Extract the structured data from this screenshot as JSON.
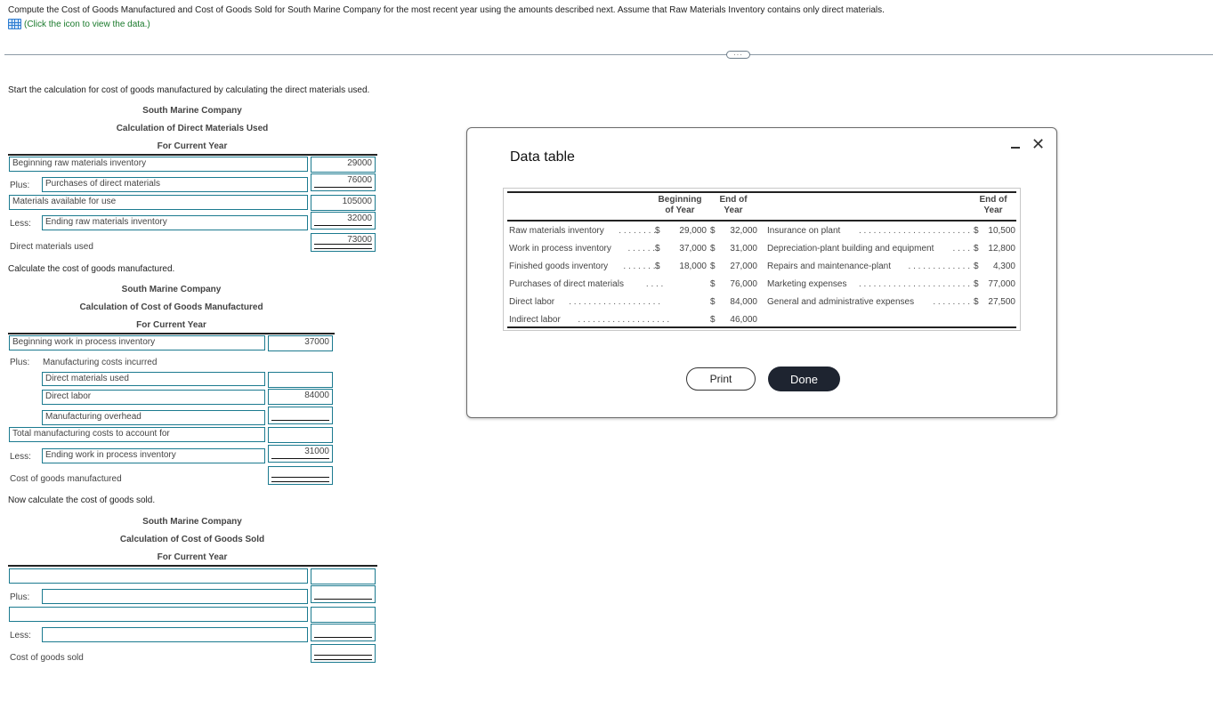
{
  "question": {
    "text": "Compute the Cost of Goods Manufactured and Cost of Goods Sold for South Marine Company for the most recent year using the amounts described next. Assume that Raw Materials Inventory contains only direct materials.",
    "data_link": "(Click the icon to view the data.)",
    "data_icon": "table-grid-icon",
    "separator_handle": "···"
  },
  "dmu": {
    "instruction": "Start the calculation for cost of goods manufactured by calculating the direct materials used.",
    "company": "South Marine Company",
    "title": "Calculation of Direct Materials Used",
    "period": "For Current Year",
    "rows": [
      {
        "prefix": "",
        "label": "Beginning raw materials inventory",
        "value": "29000"
      },
      {
        "prefix": "Plus:",
        "label": "Purchases of direct materials",
        "value": "76000"
      },
      {
        "prefix": "",
        "label": "Materials available for use",
        "value": "105000"
      },
      {
        "prefix": "Less:",
        "label": "Ending raw materials inventory",
        "value": "32000"
      },
      {
        "prefix": "",
        "label": "Direct materials used",
        "value": "73000"
      }
    ]
  },
  "cogm": {
    "instruction": "Calculate the cost of goods manufactured.",
    "company": "South Marine Company",
    "title": "Calculation of Cost of Goods Manufactured",
    "period": "For Current Year",
    "rows": [
      {
        "prefix": "",
        "label": "Beginning work in process inventory",
        "value": "37000"
      },
      {
        "prefix": "Plus:",
        "label": "Manufacturing costs incurred",
        "value": ""
      },
      {
        "prefix": "",
        "label": "Direct materials used",
        "value": ""
      },
      {
        "prefix": "",
        "label": "Direct labor",
        "value": "84000"
      },
      {
        "prefix": "",
        "label": "Manufacturing overhead",
        "value": ""
      },
      {
        "prefix": "",
        "label": "Total manufacturing costs to account for",
        "value": ""
      },
      {
        "prefix": "Less:",
        "label": "Ending work in process inventory",
        "value": "31000"
      },
      {
        "prefix": "",
        "label": "Cost of goods manufactured",
        "value": ""
      }
    ]
  },
  "cogs": {
    "instruction": "Now calculate the cost of goods sold.",
    "company": "South Marine Company",
    "title": "Calculation of Cost of Goods Sold",
    "period": "For Current Year",
    "rows": [
      {
        "prefix": "",
        "label": "",
        "value": ""
      },
      {
        "prefix": "Plus:",
        "label": "",
        "value": ""
      },
      {
        "prefix": "",
        "label": "",
        "value": ""
      },
      {
        "prefix": "Less:",
        "label": "",
        "value": ""
      },
      {
        "prefix": "",
        "label": "Cost of goods sold",
        "value": ""
      }
    ]
  },
  "modal": {
    "title": "Data table",
    "minimize_icon": "minimize-icon",
    "close_icon": "close-icon",
    "left_headers": {
      "beginning": "Beginning of Year",
      "beginning_l1": "Beginning",
      "beginning_l2": "of Year",
      "end_l1": "End of",
      "end_l2": "Year"
    },
    "right_headers": {
      "end_l1": "End of",
      "end_l2": "Year"
    },
    "left_rows": [
      {
        "label": "Raw materials inventory",
        "dots": ". . . . . . . .",
        "beg_sym": "$",
        "beg": "29,000",
        "end_sym": "$",
        "end": "32,000"
      },
      {
        "label": "Work in process inventory",
        "dots": ". . . . . . .",
        "beg_sym": "$",
        "beg": "37,000",
        "end_sym": "$",
        "end": "31,000"
      },
      {
        "label": "Finished goods inventory",
        "dots": ". . . . . . . .",
        "beg_sym": "$",
        "beg": "18,000",
        "end_sym": "$",
        "end": "27,000"
      },
      {
        "label": "Purchases of direct materials",
        "dots": ". . . .",
        "beg_sym": "",
        "beg": "",
        "end_sym": "$",
        "end": "76,000"
      },
      {
        "label": "Direct labor",
        "dots": ". . . . . . . . . . . . . . . . . . .",
        "beg_sym": "",
        "beg": "",
        "end_sym": "$",
        "end": "84,000"
      },
      {
        "label": "Indirect labor",
        "dots": ". . . . . . . . . . . . . . . . . . .",
        "beg_sym": "",
        "beg": "",
        "end_sym": "$",
        "end": "46,000"
      }
    ],
    "right_rows": [
      {
        "label": "Insurance on plant",
        "dots": ". . . . . . . . . . . . . . . . . . . . . . .",
        "sym": "$",
        "value": "10,500"
      },
      {
        "label": "Depreciation-plant building and equipment",
        "dots": ". . . .",
        "sym": "$",
        "value": "12,800"
      },
      {
        "label": "Repairs and maintenance-plant",
        "dots": ". . . . . . . . . . . . .",
        "sym": "$",
        "value": "4,300"
      },
      {
        "label": "Marketing expenses",
        "dots": ". . . . . . . . . . . . . . . . . . . . . . .",
        "sym": "$",
        "value": "77,000"
      },
      {
        "label": "General and administrative expenses",
        "dots": ". . . . . . . .",
        "sym": "$",
        "value": "27,500"
      }
    ],
    "print_label": "Print",
    "done_label": "Done"
  }
}
